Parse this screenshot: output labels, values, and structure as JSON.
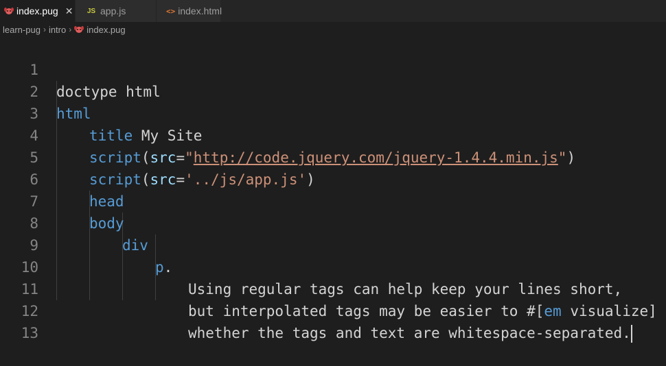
{
  "tabs": [
    {
      "label": "index.pug",
      "icon": "pug-icon",
      "active": true
    },
    {
      "label": "app.js",
      "icon": "js-icon",
      "active": false
    },
    {
      "label": "index.html",
      "icon": "html-icon",
      "active": false
    }
  ],
  "tab_close": "✕",
  "breadcrumb": [
    "learn-pug",
    "intro",
    "index.pug"
  ],
  "lines": {
    "1": {
      "n": "1",
      "a": "doctype html"
    },
    "2": {
      "n": "2",
      "a": "html"
    },
    "3": {
      "n": "3",
      "a": "title",
      "b": " My Site"
    },
    "4": {
      "n": "4",
      "a": "script",
      "b": "(",
      "c": "src",
      "d": "=",
      "e": "\"",
      "f": "http://code.jquery.com/jquery-1.4.4.min.js",
      "g": "\"",
      "h": ")"
    },
    "5": {
      "n": "5",
      "a": "script",
      "b": "(",
      "c": "src",
      "d": "=",
      "e": "'../js/app.js'",
      "f": ")"
    },
    "6": {
      "n": "6",
      "a": "head"
    },
    "7": {
      "n": "7",
      "a": "body"
    },
    "8": {
      "n": "8",
      "a": "div"
    },
    "9": {
      "n": "9",
      "a": "p",
      "b": "."
    },
    "10": {
      "n": "10",
      "a": "Using regular tags can help keep your lines short,"
    },
    "11": {
      "n": "11",
      "a": "but interpolated tags may be easier to ",
      "b": "#[",
      "c": "em",
      "d": " visualize",
      "e": "]"
    },
    "12": {
      "n": "12",
      "a": "whether the tags and text are whitespace-separated."
    },
    "13": {
      "n": "13"
    }
  },
  "colors": {
    "keyword": "#569cd6",
    "attribute": "#9cdcfe",
    "string": "#ce9178",
    "text": "#d4d4d4",
    "line_number": "#858585"
  }
}
